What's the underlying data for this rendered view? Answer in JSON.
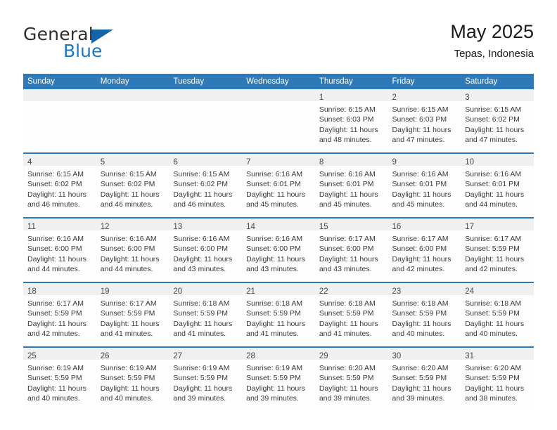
{
  "brand": {
    "name_part1": "General",
    "name_part2": "Blue"
  },
  "header": {
    "title": "May 2025",
    "subtitle": "Tepas, Indonesia"
  },
  "colors": {
    "header_blue": "#2e7ab8",
    "brand_blue": "#1c78c0",
    "daynum_band": "#f0f0f0",
    "cell_bg": "#fdfdfd"
  },
  "weekdays": [
    "Sunday",
    "Monday",
    "Tuesday",
    "Wednesday",
    "Thursday",
    "Friday",
    "Saturday"
  ],
  "weeks": [
    [
      {
        "day": "",
        "lines": []
      },
      {
        "day": "",
        "lines": []
      },
      {
        "day": "",
        "lines": []
      },
      {
        "day": "",
        "lines": []
      },
      {
        "day": "1",
        "lines": [
          "Sunrise: 6:15 AM",
          "Sunset: 6:03 PM",
          "Daylight: 11 hours",
          "and 48 minutes."
        ]
      },
      {
        "day": "2",
        "lines": [
          "Sunrise: 6:15 AM",
          "Sunset: 6:03 PM",
          "Daylight: 11 hours",
          "and 47 minutes."
        ]
      },
      {
        "day": "3",
        "lines": [
          "Sunrise: 6:15 AM",
          "Sunset: 6:02 PM",
          "Daylight: 11 hours",
          "and 47 minutes."
        ]
      }
    ],
    [
      {
        "day": "4",
        "lines": [
          "Sunrise: 6:15 AM",
          "Sunset: 6:02 PM",
          "Daylight: 11 hours",
          "and 46 minutes."
        ]
      },
      {
        "day": "5",
        "lines": [
          "Sunrise: 6:15 AM",
          "Sunset: 6:02 PM",
          "Daylight: 11 hours",
          "and 46 minutes."
        ]
      },
      {
        "day": "6",
        "lines": [
          "Sunrise: 6:15 AM",
          "Sunset: 6:02 PM",
          "Daylight: 11 hours",
          "and 46 minutes."
        ]
      },
      {
        "day": "7",
        "lines": [
          "Sunrise: 6:16 AM",
          "Sunset: 6:01 PM",
          "Daylight: 11 hours",
          "and 45 minutes."
        ]
      },
      {
        "day": "8",
        "lines": [
          "Sunrise: 6:16 AM",
          "Sunset: 6:01 PM",
          "Daylight: 11 hours",
          "and 45 minutes."
        ]
      },
      {
        "day": "9",
        "lines": [
          "Sunrise: 6:16 AM",
          "Sunset: 6:01 PM",
          "Daylight: 11 hours",
          "and 45 minutes."
        ]
      },
      {
        "day": "10",
        "lines": [
          "Sunrise: 6:16 AM",
          "Sunset: 6:01 PM",
          "Daylight: 11 hours",
          "and 44 minutes."
        ]
      }
    ],
    [
      {
        "day": "11",
        "lines": [
          "Sunrise: 6:16 AM",
          "Sunset: 6:00 PM",
          "Daylight: 11 hours",
          "and 44 minutes."
        ]
      },
      {
        "day": "12",
        "lines": [
          "Sunrise: 6:16 AM",
          "Sunset: 6:00 PM",
          "Daylight: 11 hours",
          "and 44 minutes."
        ]
      },
      {
        "day": "13",
        "lines": [
          "Sunrise: 6:16 AM",
          "Sunset: 6:00 PM",
          "Daylight: 11 hours",
          "and 43 minutes."
        ]
      },
      {
        "day": "14",
        "lines": [
          "Sunrise: 6:16 AM",
          "Sunset: 6:00 PM",
          "Daylight: 11 hours",
          "and 43 minutes."
        ]
      },
      {
        "day": "15",
        "lines": [
          "Sunrise: 6:17 AM",
          "Sunset: 6:00 PM",
          "Daylight: 11 hours",
          "and 43 minutes."
        ]
      },
      {
        "day": "16",
        "lines": [
          "Sunrise: 6:17 AM",
          "Sunset: 6:00 PM",
          "Daylight: 11 hours",
          "and 42 minutes."
        ]
      },
      {
        "day": "17",
        "lines": [
          "Sunrise: 6:17 AM",
          "Sunset: 5:59 PM",
          "Daylight: 11 hours",
          "and 42 minutes."
        ]
      }
    ],
    [
      {
        "day": "18",
        "lines": [
          "Sunrise: 6:17 AM",
          "Sunset: 5:59 PM",
          "Daylight: 11 hours",
          "and 42 minutes."
        ]
      },
      {
        "day": "19",
        "lines": [
          "Sunrise: 6:17 AM",
          "Sunset: 5:59 PM",
          "Daylight: 11 hours",
          "and 41 minutes."
        ]
      },
      {
        "day": "20",
        "lines": [
          "Sunrise: 6:18 AM",
          "Sunset: 5:59 PM",
          "Daylight: 11 hours",
          "and 41 minutes."
        ]
      },
      {
        "day": "21",
        "lines": [
          "Sunrise: 6:18 AM",
          "Sunset: 5:59 PM",
          "Daylight: 11 hours",
          "and 41 minutes."
        ]
      },
      {
        "day": "22",
        "lines": [
          "Sunrise: 6:18 AM",
          "Sunset: 5:59 PM",
          "Daylight: 11 hours",
          "and 41 minutes."
        ]
      },
      {
        "day": "23",
        "lines": [
          "Sunrise: 6:18 AM",
          "Sunset: 5:59 PM",
          "Daylight: 11 hours",
          "and 40 minutes."
        ]
      },
      {
        "day": "24",
        "lines": [
          "Sunrise: 6:18 AM",
          "Sunset: 5:59 PM",
          "Daylight: 11 hours",
          "and 40 minutes."
        ]
      }
    ],
    [
      {
        "day": "25",
        "lines": [
          "Sunrise: 6:19 AM",
          "Sunset: 5:59 PM",
          "Daylight: 11 hours",
          "and 40 minutes."
        ]
      },
      {
        "day": "26",
        "lines": [
          "Sunrise: 6:19 AM",
          "Sunset: 5:59 PM",
          "Daylight: 11 hours",
          "and 40 minutes."
        ]
      },
      {
        "day": "27",
        "lines": [
          "Sunrise: 6:19 AM",
          "Sunset: 5:59 PM",
          "Daylight: 11 hours",
          "and 39 minutes."
        ]
      },
      {
        "day": "28",
        "lines": [
          "Sunrise: 6:19 AM",
          "Sunset: 5:59 PM",
          "Daylight: 11 hours",
          "and 39 minutes."
        ]
      },
      {
        "day": "29",
        "lines": [
          "Sunrise: 6:20 AM",
          "Sunset: 5:59 PM",
          "Daylight: 11 hours",
          "and 39 minutes."
        ]
      },
      {
        "day": "30",
        "lines": [
          "Sunrise: 6:20 AM",
          "Sunset: 5:59 PM",
          "Daylight: 11 hours",
          "and 39 minutes."
        ]
      },
      {
        "day": "31",
        "lines": [
          "Sunrise: 6:20 AM",
          "Sunset: 5:59 PM",
          "Daylight: 11 hours",
          "and 38 minutes."
        ]
      }
    ]
  ]
}
